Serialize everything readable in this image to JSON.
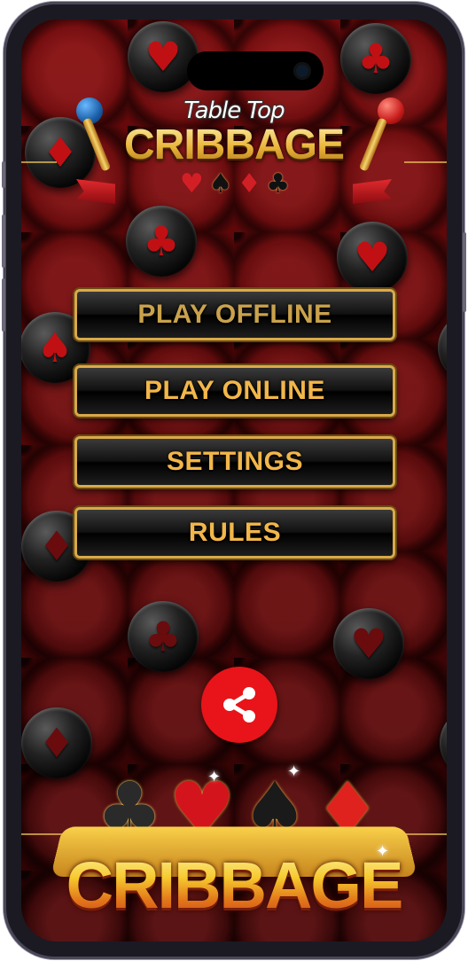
{
  "app": {
    "logo_small_line1": "Table Top",
    "logo_small_line2": "CRIBBAGE",
    "logo_bottom": "CRIBBAGE"
  },
  "suits": {
    "heart": "♥",
    "club": "♣",
    "diamond": "♦",
    "spade": "♠"
  },
  "menu": {
    "play_offline": "PLAY OFFLINE",
    "play_online": "PLAY ONLINE",
    "settings": "SETTINGS",
    "rules": "RULES"
  },
  "icons": {
    "share": "share-icon"
  },
  "colors": {
    "button_text": "#f2b64a",
    "button_border": "#d9a94a",
    "share_bg": "#e8141a",
    "background": "#5a0708"
  }
}
